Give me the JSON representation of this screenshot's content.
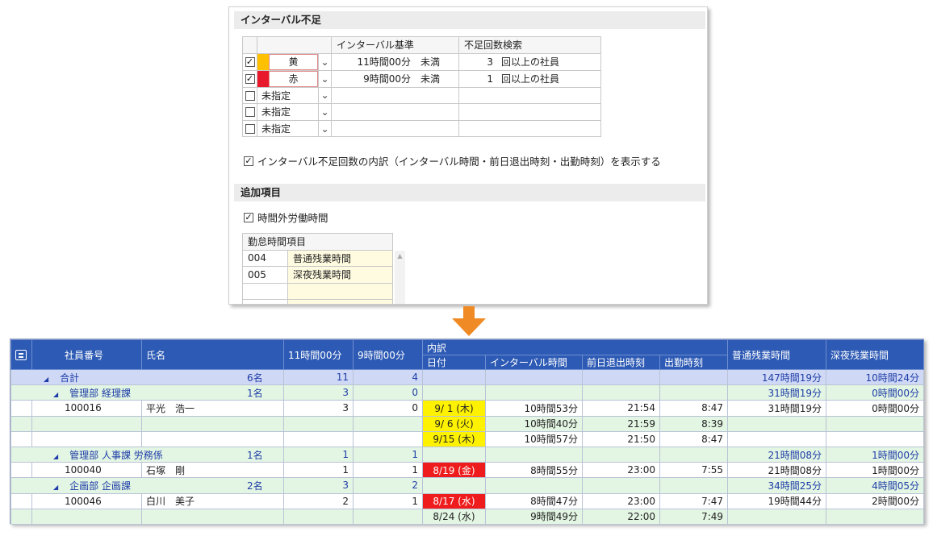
{
  "settings": {
    "interval_section_title": "インターバル不足",
    "interval_table": {
      "headers": {
        "basis": "インターバル基準",
        "count": "不足回数検索"
      },
      "rows": [
        {
          "checked": true,
          "swatch_color": "#ffc000",
          "color_label": "黄",
          "basis_time": "11時間00分",
          "basis_suffix": "未満",
          "count": "3",
          "count_suffix": "回以上の社員"
        },
        {
          "checked": true,
          "swatch_color": "#e8192c",
          "color_label": "赤",
          "basis_time": "9時間00分",
          "basis_suffix": "未満",
          "count": "1",
          "count_suffix": "回以上の社員"
        },
        {
          "checked": false,
          "swatch_color": "",
          "color_label": "未指定",
          "basis_time": "",
          "basis_suffix": "",
          "count": "",
          "count_suffix": ""
        },
        {
          "checked": false,
          "swatch_color": "",
          "color_label": "未指定",
          "basis_time": "",
          "basis_suffix": "",
          "count": "",
          "count_suffix": ""
        },
        {
          "checked": false,
          "swatch_color": "",
          "color_label": "未指定",
          "basis_time": "",
          "basis_suffix": "",
          "count": "",
          "count_suffix": ""
        }
      ]
    },
    "breakdown_option": {
      "checked": true,
      "label": "インターバル不足回数の内訳（インターバル時間・前日退出時刻・出勤時刻）を表示する"
    },
    "additional_section_title": "追加項目",
    "overtime_option": {
      "checked": true,
      "label": "時間外労働時間"
    },
    "leave_table": {
      "header": "勤怠時間項目",
      "rows": [
        {
          "code": "004",
          "name": "普通残業時間"
        },
        {
          "code": "005",
          "name": "深夜残業時間"
        },
        {
          "code": "",
          "name": ""
        },
        {
          "code": "",
          "name": ""
        }
      ]
    }
  },
  "result": {
    "headers": {
      "emp_no": "社員番号",
      "name": "氏名",
      "h11": "11時間00分",
      "h9": "9時間00分",
      "breakdown": "内訳",
      "date": "日付",
      "interval": "インターバル時間",
      "prev_exit": "前日退出時刻",
      "clock_in": "出勤時刻",
      "normal_ot": "普通残業時間",
      "night_ot": "深夜残業時間"
    },
    "rows": [
      {
        "kind": "total",
        "label": "合計",
        "count": "6名",
        "h11": "11",
        "h9": "4",
        "date": "",
        "interval": "",
        "prev_exit": "",
        "clock_in": "",
        "normal_ot": "147時間19分",
        "night_ot": "10時間24分"
      },
      {
        "kind": "dept",
        "label": "管理部 経理課",
        "count": "1名",
        "h11": "3",
        "h9": "0",
        "date": "",
        "interval": "",
        "prev_exit": "",
        "clock_in": "",
        "normal_ot": "31時間19分",
        "night_ot": "0時間00分"
      },
      {
        "kind": "emp",
        "emp_no": "100016",
        "name": "平光　浩一",
        "h11": "3",
        "h9": "0",
        "date": "9/  1 (木)",
        "date_color": "yellow",
        "interval": "10時間53分",
        "prev_exit": "21:54",
        "clock_in": "8:47",
        "normal_ot": "31時間19分",
        "night_ot": "0時間00分"
      },
      {
        "kind": "sub",
        "date": "9/  6 (火)",
        "date_color": "yellow",
        "interval": "10時間40分",
        "prev_exit": "21:59",
        "clock_in": "8:39",
        "normal_ot": "",
        "night_ot": ""
      },
      {
        "kind": "emp-sub",
        "date": "9/15 (木)",
        "date_color": "yellow",
        "interval": "10時間57分",
        "prev_exit": "21:50",
        "clock_in": "8:47",
        "normal_ot": "",
        "night_ot": ""
      },
      {
        "kind": "dept",
        "label": "管理部 人事課 労務係",
        "count": "1名",
        "h11": "1",
        "h9": "1",
        "date": "",
        "interval": "",
        "prev_exit": "",
        "clock_in": "",
        "normal_ot": "21時間08分",
        "night_ot": "1時間00分"
      },
      {
        "kind": "emp",
        "emp_no": "100040",
        "name": "石塚　剛",
        "h11": "1",
        "h9": "1",
        "date": "8/19 (金)",
        "date_color": "red",
        "interval": "8時間55分",
        "prev_exit": "23:00",
        "clock_in": "7:55",
        "normal_ot": "21時間08分",
        "night_ot": "1時間00分"
      },
      {
        "kind": "dept",
        "label": "企画部 企画課",
        "count": "2名",
        "h11": "3",
        "h9": "2",
        "date": "",
        "interval": "",
        "prev_exit": "",
        "clock_in": "",
        "normal_ot": "34時間25分",
        "night_ot": "4時間05分"
      },
      {
        "kind": "emp",
        "emp_no": "100046",
        "name": "白川　美子",
        "h11": "2",
        "h9": "1",
        "date": "8/17 (水)",
        "date_color": "red",
        "interval": "8時間47分",
        "prev_exit": "23:00",
        "clock_in": "7:47",
        "normal_ot": "19時間44分",
        "night_ot": "2時間00分"
      },
      {
        "kind": "sub",
        "date": "8/24 (水)",
        "date_color": "",
        "interval": "9時間49分",
        "prev_exit": "22:00",
        "clock_in": "7:49",
        "normal_ot": "",
        "night_ot": ""
      }
    ]
  },
  "colors": {
    "header_blue": "#2d5ab4",
    "arrow_orange": "#f08a24",
    "total_row": "#cfd8f5",
    "dept_row": "#e3f5e3"
  },
  "icons": {
    "arrow": "arrow-down-icon",
    "collapse": "tree-collapse-icon",
    "checkbox": "checkbox-icon",
    "chevron": "chevron-down-icon"
  }
}
